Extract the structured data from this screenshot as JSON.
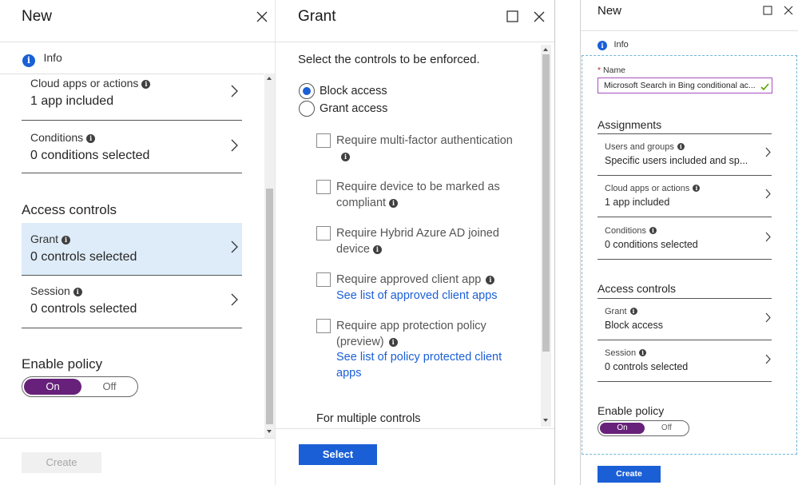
{
  "blade1": {
    "title": "New",
    "info_label": "Info",
    "rows": [
      {
        "label": "Cloud apps or actions",
        "value": "1 app included"
      },
      {
        "label": "Conditions",
        "value": "0 conditions selected"
      }
    ],
    "access_controls_heading": "Access controls",
    "access_rows": [
      {
        "label": "Grant",
        "value": "0 controls selected"
      },
      {
        "label": "Session",
        "value": "0 controls selected"
      }
    ],
    "enable_policy_label": "Enable policy",
    "toggle": {
      "on": "On",
      "off": "Off",
      "selected": "On"
    },
    "create_label": "Create"
  },
  "blade2": {
    "title": "Grant",
    "instructions": "Select the controls to be enforced.",
    "radios": [
      {
        "label": "Block access",
        "selected": true
      },
      {
        "label": "Grant access",
        "selected": false
      }
    ],
    "controls": [
      {
        "line1": "Require multi-factor authentication",
        "line2": ""
      },
      {
        "line1": "Require device to be marked as",
        "line2": "compliant"
      },
      {
        "line1": "Require Hybrid Azure AD joined",
        "line2": "device"
      },
      {
        "line1": "Require approved client app",
        "link": "See list of approved client apps"
      },
      {
        "line1": "Require app protection policy",
        "line2": "(preview)",
        "link1": "See list of policy protected client",
        "link2": "apps"
      }
    ],
    "multiple_controls": "For multiple controls",
    "select_label": "Select"
  },
  "blade3": {
    "title": "New",
    "info_label": "Info",
    "name_label": "Name",
    "name_required": "*",
    "name_value": "Microsoft Search in Bing conditional ac...",
    "assignments_heading": "Assignments",
    "assignment_rows": [
      {
        "label": "Users and groups",
        "value": "Specific users included and sp..."
      },
      {
        "label": "Cloud apps or actions",
        "value": "1 app included"
      },
      {
        "label": "Conditions",
        "value": "0 conditions selected"
      }
    ],
    "access_controls_heading": "Access controls",
    "access_rows": [
      {
        "label": "Grant",
        "value": "Block access"
      },
      {
        "label": "Session",
        "value": "0 controls selected"
      }
    ],
    "enable_policy_label": "Enable policy",
    "toggle": {
      "on": "On",
      "off": "Off",
      "selected": "On"
    },
    "create_label": "Create"
  },
  "colors": {
    "accent_blue": "#1a5fd6",
    "toggle_purple": "#68217a",
    "selected_row": "#deecf9",
    "name_border": "#a84fbf",
    "valid_check": "#57a300"
  },
  "icons": [
    "close-icon",
    "maximize-icon",
    "info-icon",
    "chevron-right-icon",
    "checkmark-icon"
  ]
}
